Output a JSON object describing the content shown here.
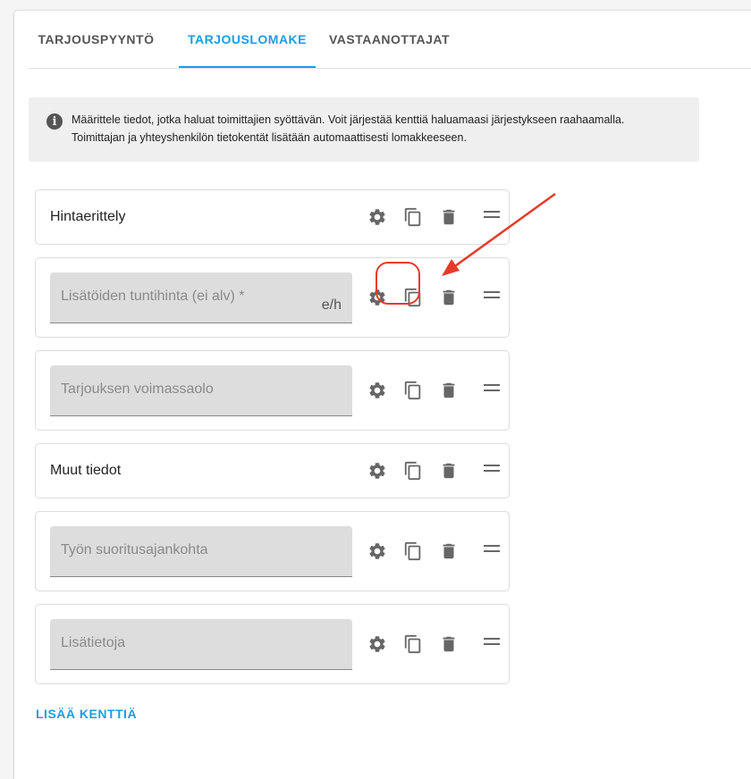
{
  "tabs": [
    {
      "label": "TARJOUSPYYNTÖ",
      "active": false
    },
    {
      "label": "TARJOUSLOMAKE",
      "active": true
    },
    {
      "label": "VASTAANOTTAJAT",
      "active": false
    }
  ],
  "info": {
    "icon": "info-icon",
    "line1": "Määrittele tiedot, jotka haluat toimittajien syöttävän. Voit järjestää kenttiä haluamaasi järjestykseen raahaamalla.",
    "line2": "Toimittajan ja yhteyshenkilön tietokentät lisätään automaattisesti lomakkeeseen."
  },
  "fields": [
    {
      "type": "heading",
      "label": "Hintaerittely"
    },
    {
      "type": "input",
      "label": "Lisätöiden tuntihinta (ei alv) *",
      "suffix": "e/h",
      "highlighted": true
    },
    {
      "type": "input",
      "label": "Tarjouksen voimassaolo"
    },
    {
      "type": "heading",
      "label": "Muut tiedot"
    },
    {
      "type": "input",
      "label": "Työn suoritusajankohta"
    },
    {
      "type": "input",
      "label": "Lisätietoja"
    }
  ],
  "row_icons": [
    "gear-icon",
    "copy-icon",
    "trash-icon",
    "drag-handle-icon"
  ],
  "add_field_label": "LISÄÄ KENTTIÄ",
  "colors": {
    "accent": "#1a9ee0",
    "annotation": "#e53b2a",
    "icon": "#666666"
  }
}
